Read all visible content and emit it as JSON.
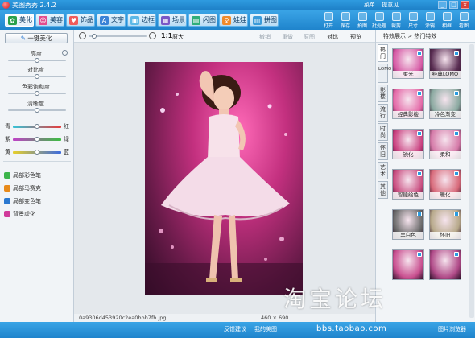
{
  "window": {
    "title": "美图秀秀 2.4.2",
    "links": [
      "菜单",
      "提意见"
    ],
    "minimize": "_",
    "maximize": "□",
    "close": "×"
  },
  "tabs": [
    {
      "label": "美化",
      "icon": "palette-icon",
      "active": true
    },
    {
      "label": "美容",
      "icon": "face-icon"
    },
    {
      "label": "饰品",
      "icon": "heart-icon"
    },
    {
      "label": "文字",
      "icon": "text-icon"
    },
    {
      "label": "边框",
      "icon": "frame-icon"
    },
    {
      "label": "场景",
      "icon": "scene-icon"
    },
    {
      "label": "闪图",
      "icon": "flash-icon"
    },
    {
      "label": "娃娃",
      "icon": "doll-icon"
    },
    {
      "label": "拼图",
      "icon": "puzzle-icon"
    }
  ],
  "toolbar": [
    "打开",
    "保存",
    "拍图",
    "批处理",
    "裁剪",
    "尺寸",
    "涂鸦",
    "相框",
    "看图"
  ],
  "left_panel": {
    "onekey_label": "一键美化",
    "sliders": [
      {
        "label": "亮度",
        "value": 0.5
      },
      {
        "label": "对比度",
        "value": 0.5
      },
      {
        "label": "色彩饱和度",
        "value": 0.5
      },
      {
        "label": "清晰度",
        "value": 0.5
      }
    ],
    "color_balance": [
      {
        "left": "青",
        "right": "红",
        "value": 0.5
      },
      {
        "left": "紫",
        "right": "绿",
        "value": 0.5
      },
      {
        "left": "黄",
        "right": "蓝",
        "value": 0.5
      }
    ],
    "tools": [
      {
        "label": "局部彩色笔",
        "icon": "color-pen-icon",
        "color": "#3cb44b"
      },
      {
        "label": "局部马赛克",
        "icon": "mosaic-icon",
        "color": "#e88a1a"
      },
      {
        "label": "局部变色笔",
        "icon": "recolor-pen-icon",
        "color": "#2a78d0"
      },
      {
        "label": "背景虚化",
        "icon": "blur-icon",
        "color": "#d03a9a"
      }
    ]
  },
  "canvas": {
    "zoom_label": "1:1",
    "original_label": "原大",
    "actions": [
      "撤销",
      "重做",
      "原图",
      "对比",
      "预览"
    ],
    "filename": "0a9306d453920c2ea0bbb7fb.jpg",
    "dimensions": "460 × 690"
  },
  "right_panel": {
    "header": "特效展示 > 热门特效",
    "vertical_tabs": [
      "热门",
      "LOMO",
      "影楼",
      "流行",
      "时尚",
      "怀旧",
      "艺术",
      "其他"
    ],
    "effects": [
      {
        "label": "柔光",
        "tint": "#d65aa5"
      },
      {
        "label": "经典LOMO",
        "tint": "#5a2e53"
      },
      {
        "label": "经典影楼",
        "tint": "#e46aa8"
      },
      {
        "label": "冷色渐变",
        "tint": "#8aa9a0"
      },
      {
        "label": "锐化",
        "tint": "#c9407f"
      },
      {
        "label": "柔和",
        "tint": "#d57aa8"
      },
      {
        "label": "智能绘色",
        "tint": "#c94e80"
      },
      {
        "label": "暖化",
        "tint": "#d86a7a"
      },
      {
        "label": "黑白色",
        "tint": "#6a6a6a"
      },
      {
        "label": "怀旧",
        "tint": "#b7a98a"
      },
      {
        "label": "",
        "tint": "#c95090"
      },
      {
        "label": "",
        "tint": "#b04a88"
      }
    ]
  },
  "bottom_bar": {
    "items": [
      "反馈建议",
      "我的美图",
      "图片浏览器"
    ]
  },
  "watermark": {
    "main": "淘宝论坛",
    "url": "bbs.taobao.com"
  }
}
